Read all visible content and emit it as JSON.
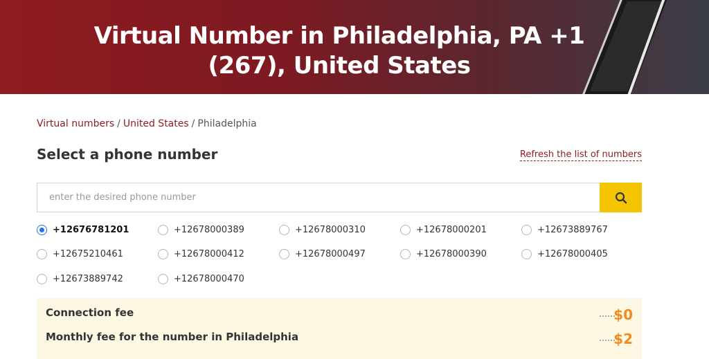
{
  "hero": {
    "title_line1": "Virtual Number in Philadelphia, PA +1",
    "title_line2": "(267), United States"
  },
  "breadcrumb": {
    "items": [
      "Virtual numbers",
      "United States",
      "Philadelphia"
    ],
    "separator": "/"
  },
  "section": {
    "title": "Select a phone number",
    "refresh_label": "Refresh the list of numbers"
  },
  "search": {
    "placeholder": "enter the desired phone number",
    "value": "",
    "icon": "search-icon"
  },
  "numbers": [
    {
      "label": "+12676781201",
      "selected": true
    },
    {
      "label": "+12678000389",
      "selected": false
    },
    {
      "label": "+12678000310",
      "selected": false
    },
    {
      "label": "+12678000201",
      "selected": false
    },
    {
      "label": "+12673889767",
      "selected": false
    },
    {
      "label": "+12675210461",
      "selected": false
    },
    {
      "label": "+12678000412",
      "selected": false
    },
    {
      "label": "+12678000497",
      "selected": false
    },
    {
      "label": "+12678000390",
      "selected": false
    },
    {
      "label": "+12678000405",
      "selected": false
    },
    {
      "label": "+12673889742",
      "selected": false
    },
    {
      "label": "+12678000470",
      "selected": false
    }
  ],
  "fees": {
    "connection_label": "Connection fee",
    "connection_value": "$0",
    "monthly_label": "Monthly fee for the number in Philadelphia",
    "monthly_value": "$2"
  },
  "colors": {
    "brand_red": "#8e1b1f",
    "search_button": "#f5c400",
    "price_orange": "#f28a1e",
    "radio_checked": "#1e73e8",
    "fee_background": "#fdf8e4"
  }
}
